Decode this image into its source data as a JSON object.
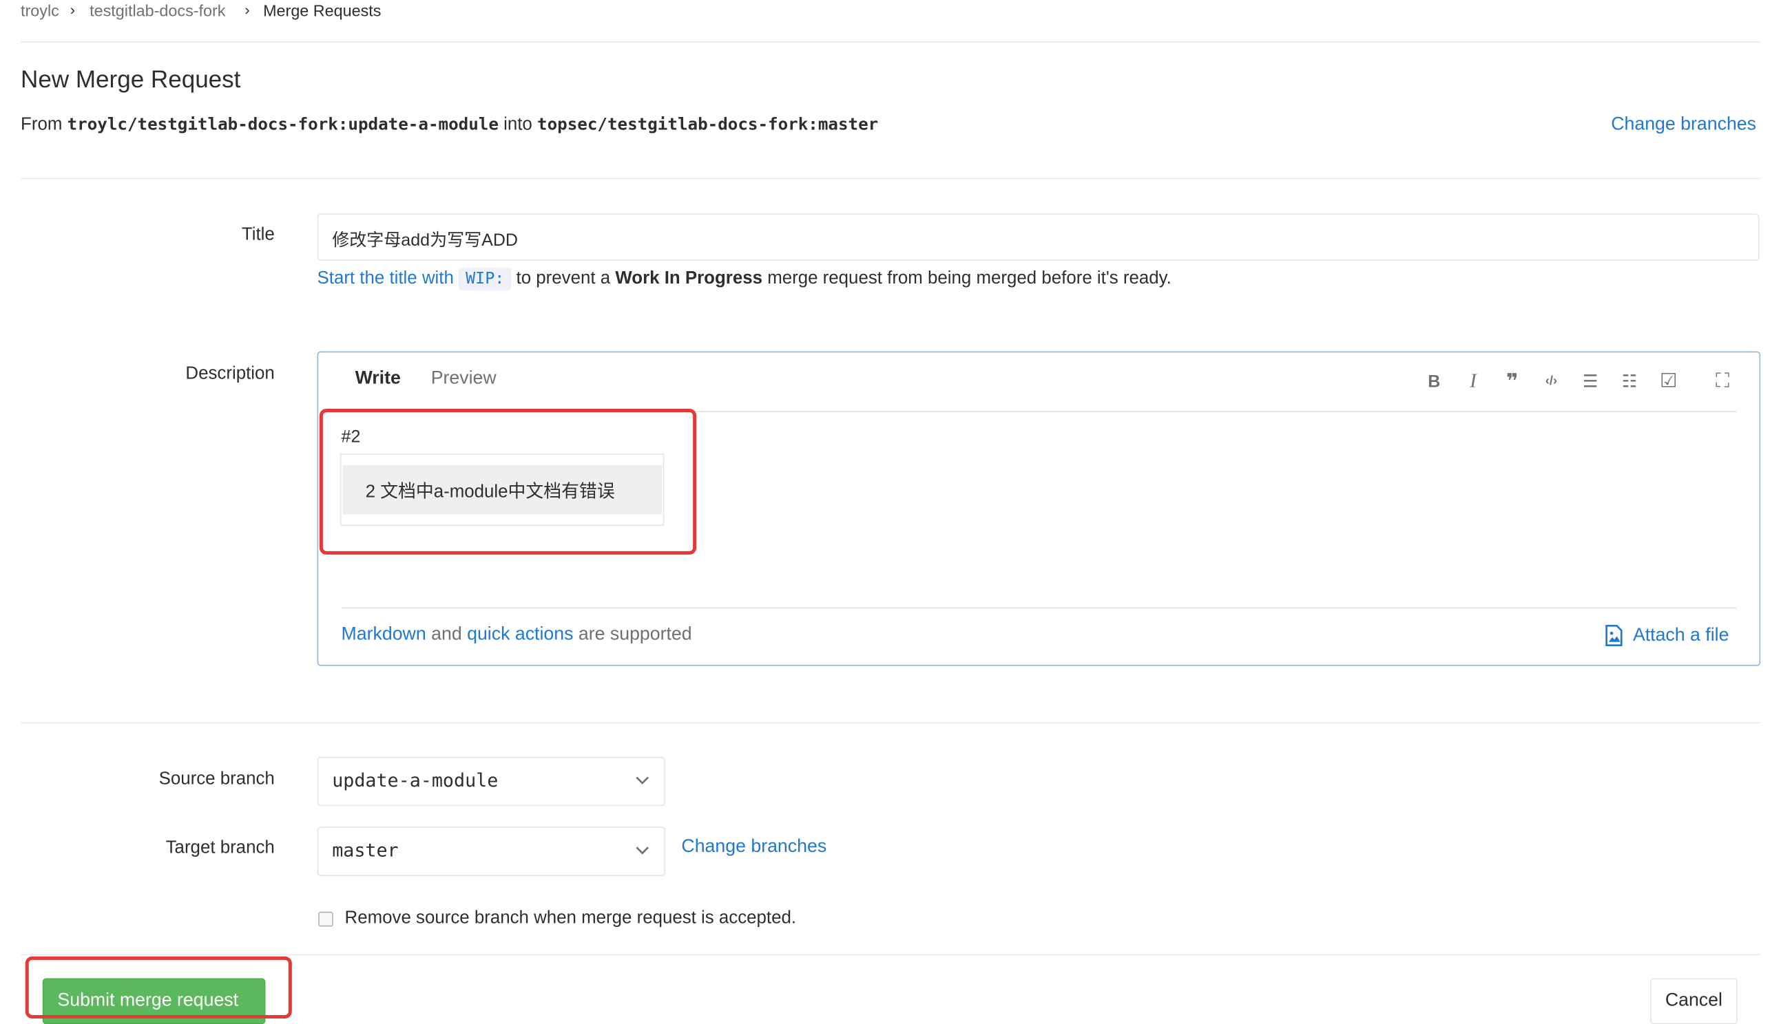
{
  "breadcrumb": {
    "items": [
      "troylc",
      "testgitlab-docs-fork",
      "Merge Requests"
    ],
    "separator": "›"
  },
  "header": {
    "title": "New Merge Request",
    "from_word": "From",
    "source_ref": "troylc/testgitlab-docs-fork:update-a-module",
    "into_word": "into",
    "target_ref": "topsec/testgitlab-docs-fork:master",
    "change_branches": "Change branches"
  },
  "form": {
    "title_label": "Title",
    "title_value": "修改字母add为写写ADD",
    "wip_hint": {
      "part1": "Start the title with",
      "code": "WIP:",
      "part2": "to prevent a",
      "bold": "Work In Progress",
      "part3": "merge request from being merged before it's ready."
    },
    "description_label": "Description",
    "tabs": [
      "Write",
      "Preview"
    ],
    "toolbar_icons": [
      "bold-icon",
      "italic-icon",
      "quote-icon",
      "code-icon",
      "bullet-list-icon",
      "numbered-list-icon",
      "task-list-icon",
      "fullscreen-icon"
    ],
    "toolbar_glyphs": [
      "B",
      "I",
      "❞",
      "‹/›",
      "☰",
      "☷",
      "☑",
      "⛶"
    ],
    "description_text": "#2",
    "autocomplete_item": "2 文档中a-module中文档有错误",
    "markdown_link": "Markdown",
    "and_word": "and",
    "quick_actions_link": "quick actions",
    "supported_text": "are supported",
    "attach_file": "Attach a file",
    "source_branch_label": "Source branch",
    "source_branch_value": "update-a-module",
    "target_branch_label": "Target branch",
    "target_branch_value": "master",
    "change_branches": "Change branches",
    "remove_source_label": "Remove source branch when merge request is accepted.",
    "submit_label": "Submit merge request",
    "cancel_label": "Cancel"
  },
  "colors": {
    "link": "#1f78d1",
    "submit": "#5cb85c",
    "highlight_box": "#e53935",
    "focus_border": "#8fbce6"
  }
}
